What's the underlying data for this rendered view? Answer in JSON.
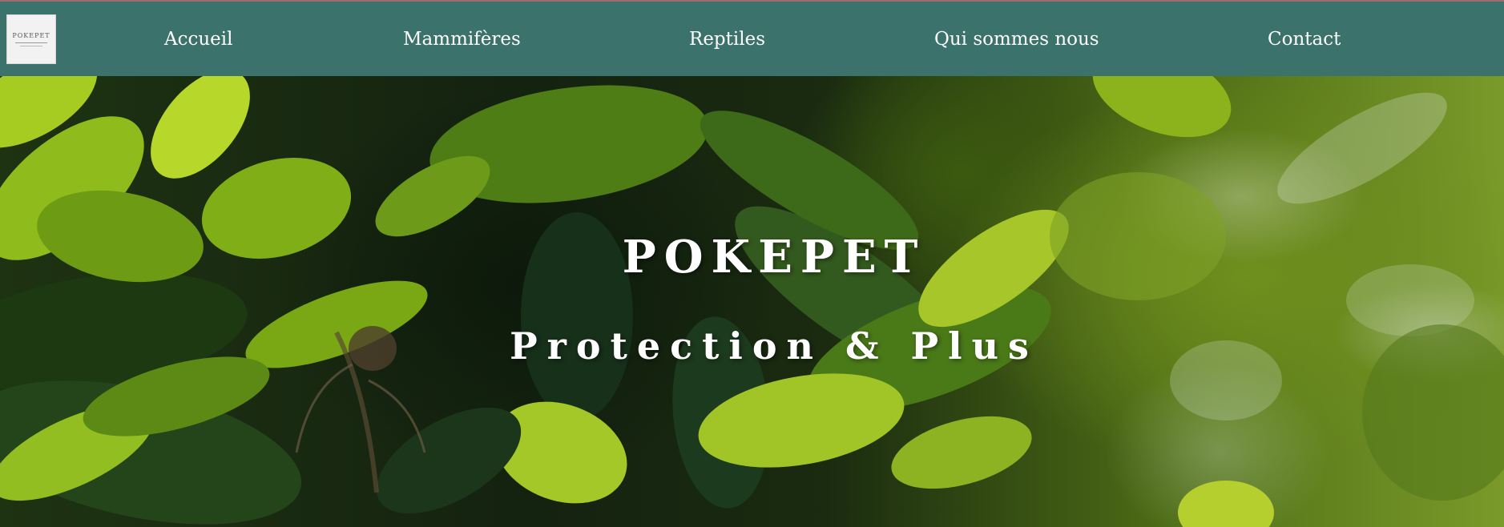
{
  "logo": {
    "text": "POKEPET"
  },
  "nav": {
    "items": [
      {
        "label": "Accueil"
      },
      {
        "label": "Mammifères"
      },
      {
        "label": "Reptiles"
      },
      {
        "label": "Qui sommes nous"
      },
      {
        "label": "Contact"
      }
    ]
  },
  "hero": {
    "title": "POKEPET",
    "subtitle": "Protection & Plus"
  },
  "colors": {
    "nav_background": "#3b726c",
    "nav_text": "#ffffff",
    "hero_text": "#ffffff"
  }
}
